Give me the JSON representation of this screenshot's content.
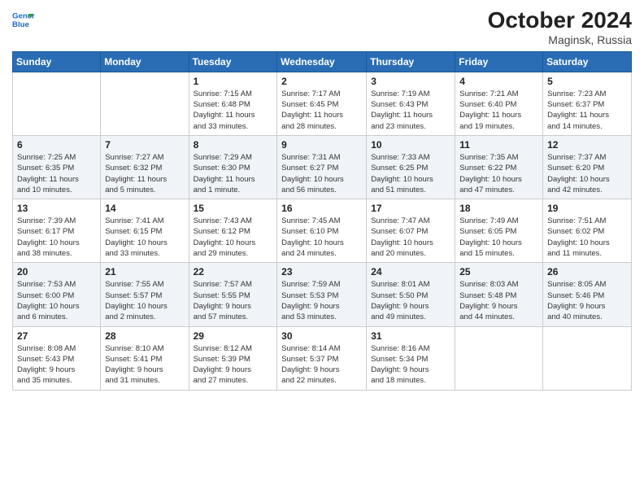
{
  "header": {
    "logo_line1": "General",
    "logo_line2": "Blue",
    "month_year": "October 2024",
    "location": "Maginsk, Russia"
  },
  "weekdays": [
    "Sunday",
    "Monday",
    "Tuesday",
    "Wednesday",
    "Thursday",
    "Friday",
    "Saturday"
  ],
  "weeks": [
    [
      {
        "day": "",
        "info": ""
      },
      {
        "day": "",
        "info": ""
      },
      {
        "day": "1",
        "info": "Sunrise: 7:15 AM\nSunset: 6:48 PM\nDaylight: 11 hours\nand 33 minutes."
      },
      {
        "day": "2",
        "info": "Sunrise: 7:17 AM\nSunset: 6:45 PM\nDaylight: 11 hours\nand 28 minutes."
      },
      {
        "day": "3",
        "info": "Sunrise: 7:19 AM\nSunset: 6:43 PM\nDaylight: 11 hours\nand 23 minutes."
      },
      {
        "day": "4",
        "info": "Sunrise: 7:21 AM\nSunset: 6:40 PM\nDaylight: 11 hours\nand 19 minutes."
      },
      {
        "day": "5",
        "info": "Sunrise: 7:23 AM\nSunset: 6:37 PM\nDaylight: 11 hours\nand 14 minutes."
      }
    ],
    [
      {
        "day": "6",
        "info": "Sunrise: 7:25 AM\nSunset: 6:35 PM\nDaylight: 11 hours\nand 10 minutes."
      },
      {
        "day": "7",
        "info": "Sunrise: 7:27 AM\nSunset: 6:32 PM\nDaylight: 11 hours\nand 5 minutes."
      },
      {
        "day": "8",
        "info": "Sunrise: 7:29 AM\nSunset: 6:30 PM\nDaylight: 11 hours\nand 1 minute."
      },
      {
        "day": "9",
        "info": "Sunrise: 7:31 AM\nSunset: 6:27 PM\nDaylight: 10 hours\nand 56 minutes."
      },
      {
        "day": "10",
        "info": "Sunrise: 7:33 AM\nSunset: 6:25 PM\nDaylight: 10 hours\nand 51 minutes."
      },
      {
        "day": "11",
        "info": "Sunrise: 7:35 AM\nSunset: 6:22 PM\nDaylight: 10 hours\nand 47 minutes."
      },
      {
        "day": "12",
        "info": "Sunrise: 7:37 AM\nSunset: 6:20 PM\nDaylight: 10 hours\nand 42 minutes."
      }
    ],
    [
      {
        "day": "13",
        "info": "Sunrise: 7:39 AM\nSunset: 6:17 PM\nDaylight: 10 hours\nand 38 minutes."
      },
      {
        "day": "14",
        "info": "Sunrise: 7:41 AM\nSunset: 6:15 PM\nDaylight: 10 hours\nand 33 minutes."
      },
      {
        "day": "15",
        "info": "Sunrise: 7:43 AM\nSunset: 6:12 PM\nDaylight: 10 hours\nand 29 minutes."
      },
      {
        "day": "16",
        "info": "Sunrise: 7:45 AM\nSunset: 6:10 PM\nDaylight: 10 hours\nand 24 minutes."
      },
      {
        "day": "17",
        "info": "Sunrise: 7:47 AM\nSunset: 6:07 PM\nDaylight: 10 hours\nand 20 minutes."
      },
      {
        "day": "18",
        "info": "Sunrise: 7:49 AM\nSunset: 6:05 PM\nDaylight: 10 hours\nand 15 minutes."
      },
      {
        "day": "19",
        "info": "Sunrise: 7:51 AM\nSunset: 6:02 PM\nDaylight: 10 hours\nand 11 minutes."
      }
    ],
    [
      {
        "day": "20",
        "info": "Sunrise: 7:53 AM\nSunset: 6:00 PM\nDaylight: 10 hours\nand 6 minutes."
      },
      {
        "day": "21",
        "info": "Sunrise: 7:55 AM\nSunset: 5:57 PM\nDaylight: 10 hours\nand 2 minutes."
      },
      {
        "day": "22",
        "info": "Sunrise: 7:57 AM\nSunset: 5:55 PM\nDaylight: 9 hours\nand 57 minutes."
      },
      {
        "day": "23",
        "info": "Sunrise: 7:59 AM\nSunset: 5:53 PM\nDaylight: 9 hours\nand 53 minutes."
      },
      {
        "day": "24",
        "info": "Sunrise: 8:01 AM\nSunset: 5:50 PM\nDaylight: 9 hours\nand 49 minutes."
      },
      {
        "day": "25",
        "info": "Sunrise: 8:03 AM\nSunset: 5:48 PM\nDaylight: 9 hours\nand 44 minutes."
      },
      {
        "day": "26",
        "info": "Sunrise: 8:05 AM\nSunset: 5:46 PM\nDaylight: 9 hours\nand 40 minutes."
      }
    ],
    [
      {
        "day": "27",
        "info": "Sunrise: 8:08 AM\nSunset: 5:43 PM\nDaylight: 9 hours\nand 35 minutes."
      },
      {
        "day": "28",
        "info": "Sunrise: 8:10 AM\nSunset: 5:41 PM\nDaylight: 9 hours\nand 31 minutes."
      },
      {
        "day": "29",
        "info": "Sunrise: 8:12 AM\nSunset: 5:39 PM\nDaylight: 9 hours\nand 27 minutes."
      },
      {
        "day": "30",
        "info": "Sunrise: 8:14 AM\nSunset: 5:37 PM\nDaylight: 9 hours\nand 22 minutes."
      },
      {
        "day": "31",
        "info": "Sunrise: 8:16 AM\nSunset: 5:34 PM\nDaylight: 9 hours\nand 18 minutes."
      },
      {
        "day": "",
        "info": ""
      },
      {
        "day": "",
        "info": ""
      }
    ]
  ]
}
